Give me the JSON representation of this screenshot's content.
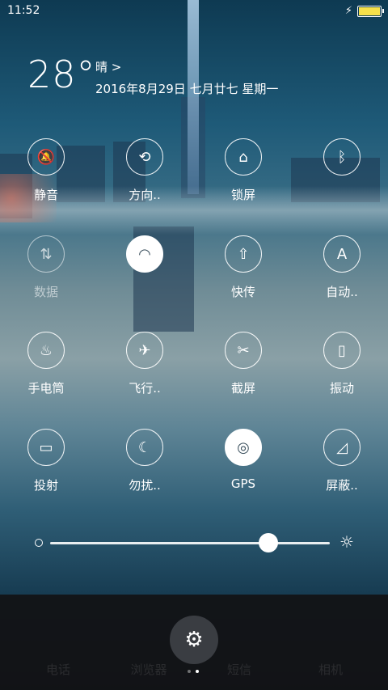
{
  "status": {
    "time": "11:52"
  },
  "weather": {
    "temperature": "28°",
    "condition": "晴 >",
    "date": "2016年8月29日 七月廿七 星期一"
  },
  "toggles": [
    {
      "label": "静音",
      "icon": "bell-muted-icon",
      "glyph": "🔕"
    },
    {
      "label": "方向..",
      "icon": "rotation-lock-icon",
      "glyph": "⟲"
    },
    {
      "label": "锁屏",
      "icon": "lock-icon",
      "glyph": "⌂"
    },
    {
      "label": "",
      "icon": "bluetooth-icon",
      "glyph": "ᛒ"
    },
    {
      "label": "数据",
      "icon": "mobile-data-icon",
      "glyph": "⇅"
    },
    {
      "label": "",
      "icon": "wifi-icon",
      "glyph": "◠"
    },
    {
      "label": "快传",
      "icon": "quick-transfer-icon",
      "glyph": "⇧"
    },
    {
      "label": "自动..",
      "icon": "auto-brightness-icon",
      "glyph": "A"
    },
    {
      "label": "手电筒",
      "icon": "flashlight-icon",
      "glyph": "♨"
    },
    {
      "label": "飞行..",
      "icon": "airplane-icon",
      "glyph": "✈"
    },
    {
      "label": "截屏",
      "icon": "screenshot-icon",
      "glyph": "✂"
    },
    {
      "label": "振动",
      "icon": "vibrate-icon",
      "glyph": "▯"
    },
    {
      "label": "投射",
      "icon": "cast-icon",
      "glyph": "▭"
    },
    {
      "label": "勿扰..",
      "icon": "do-not-disturb-icon",
      "glyph": "☾"
    },
    {
      "label": "GPS",
      "icon": "gps-icon",
      "glyph": "◎"
    },
    {
      "label": "屏蔽..",
      "icon": "block-icon",
      "glyph": "◿"
    }
  ],
  "brightness": {
    "level": 0.78
  },
  "dock": {
    "items": [
      "电话",
      "浏览器",
      "短信",
      "相机"
    ]
  },
  "colors": {
    "accent": "#ffffff",
    "battery": "#f5e04a",
    "active_icon": "#3a4f5c"
  }
}
